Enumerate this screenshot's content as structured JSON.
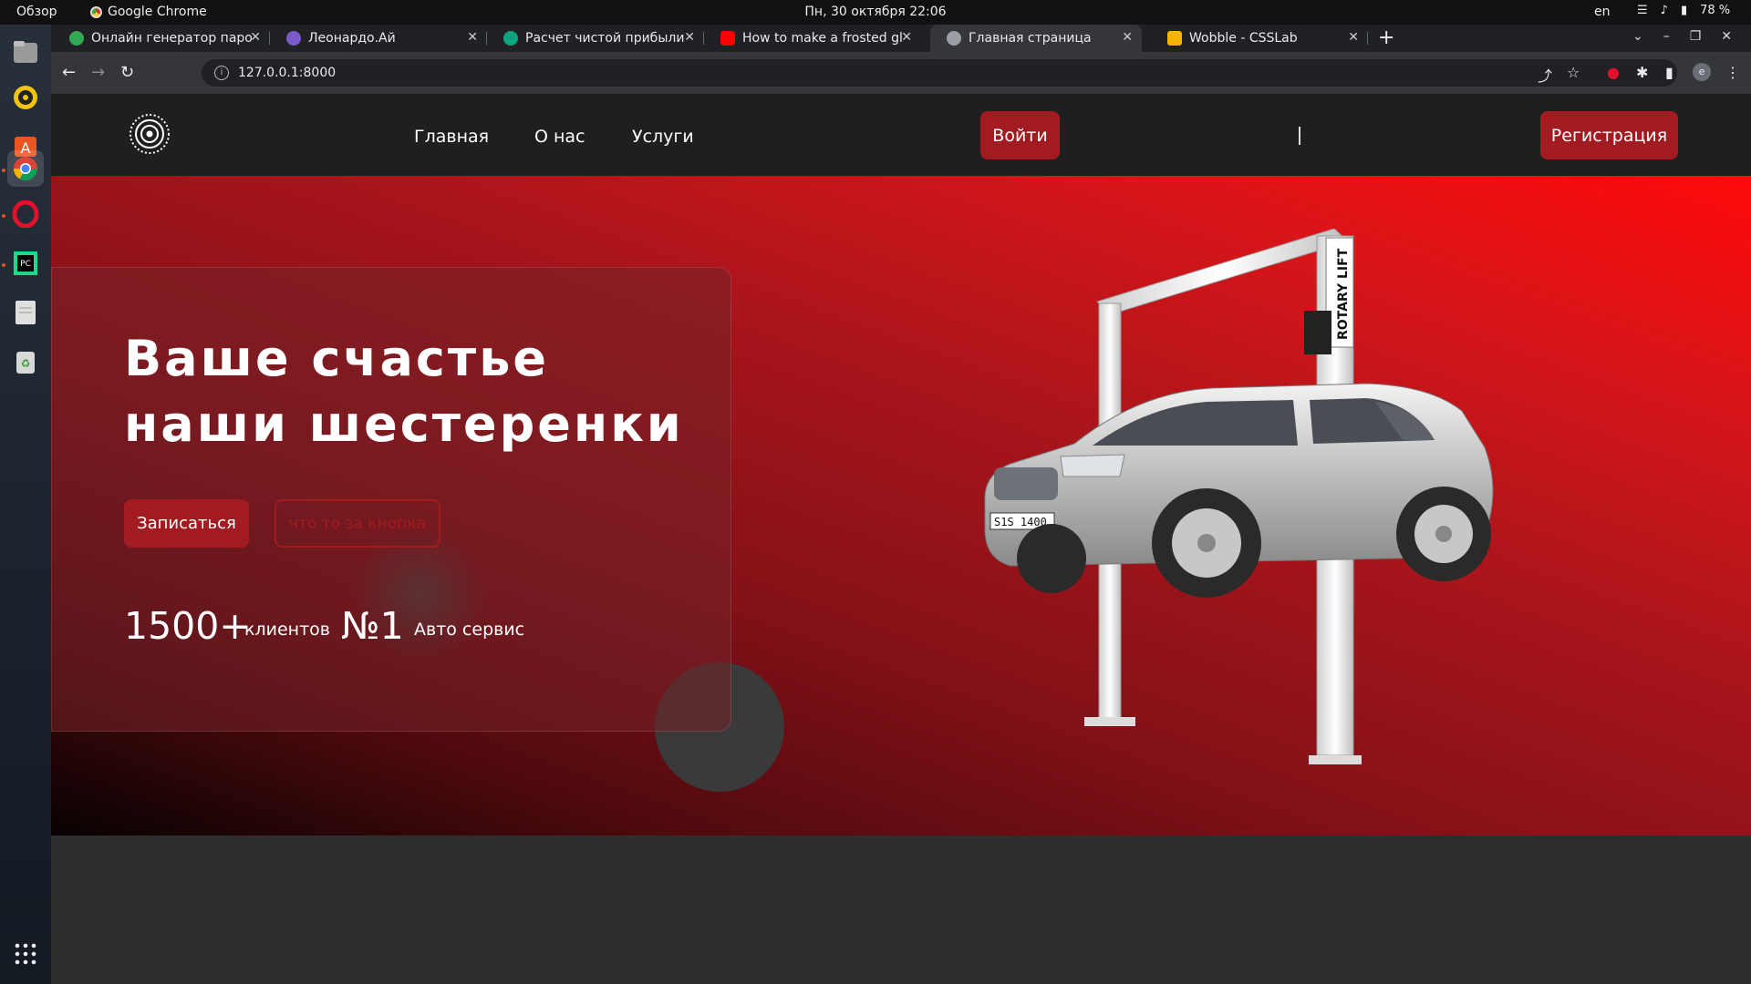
{
  "topbar": {
    "overview": "Обзор",
    "app_name": "Google Chrome",
    "clock": "Пн, 30 октября  22:06",
    "lang": "en",
    "battery": "78 %"
  },
  "tabs": [
    {
      "title": "Онлайн генератор паро",
      "color": "#34a853"
    },
    {
      "title": "Леонардо.Ай",
      "color": "#7b5ac9"
    },
    {
      "title": "Расчет чистой прибыли",
      "color": "#10a37f"
    },
    {
      "title": "How to make a frosted gl",
      "color": "#ff0000"
    },
    {
      "title": "Главная страница",
      "color": "#9aa0a6"
    },
    {
      "title": "Wobble - CSSLab",
      "color": "#f4b400"
    }
  ],
  "address": "127.0.0.1:8000",
  "site": {
    "nav": [
      "Главная",
      "О нас",
      "Услуги"
    ],
    "login": "Войти",
    "divider": "|",
    "register": "Регистрация",
    "hero_title": "Ваше счастье наши шестеренки",
    "cta_primary": "Записаться",
    "cta_secondary": "что то за кнопка",
    "stats": [
      {
        "num": "1500+",
        "label": "клиентов"
      },
      {
        "num": "№1",
        "label": "Авто сервис"
      }
    ],
    "lift_brand": "ROTARY LIFT",
    "plate": "S1S 1400"
  },
  "colors": {
    "accent": "#a11b20",
    "hero_top": "#ff0a0a",
    "header_bg": "#1f1f1f"
  }
}
